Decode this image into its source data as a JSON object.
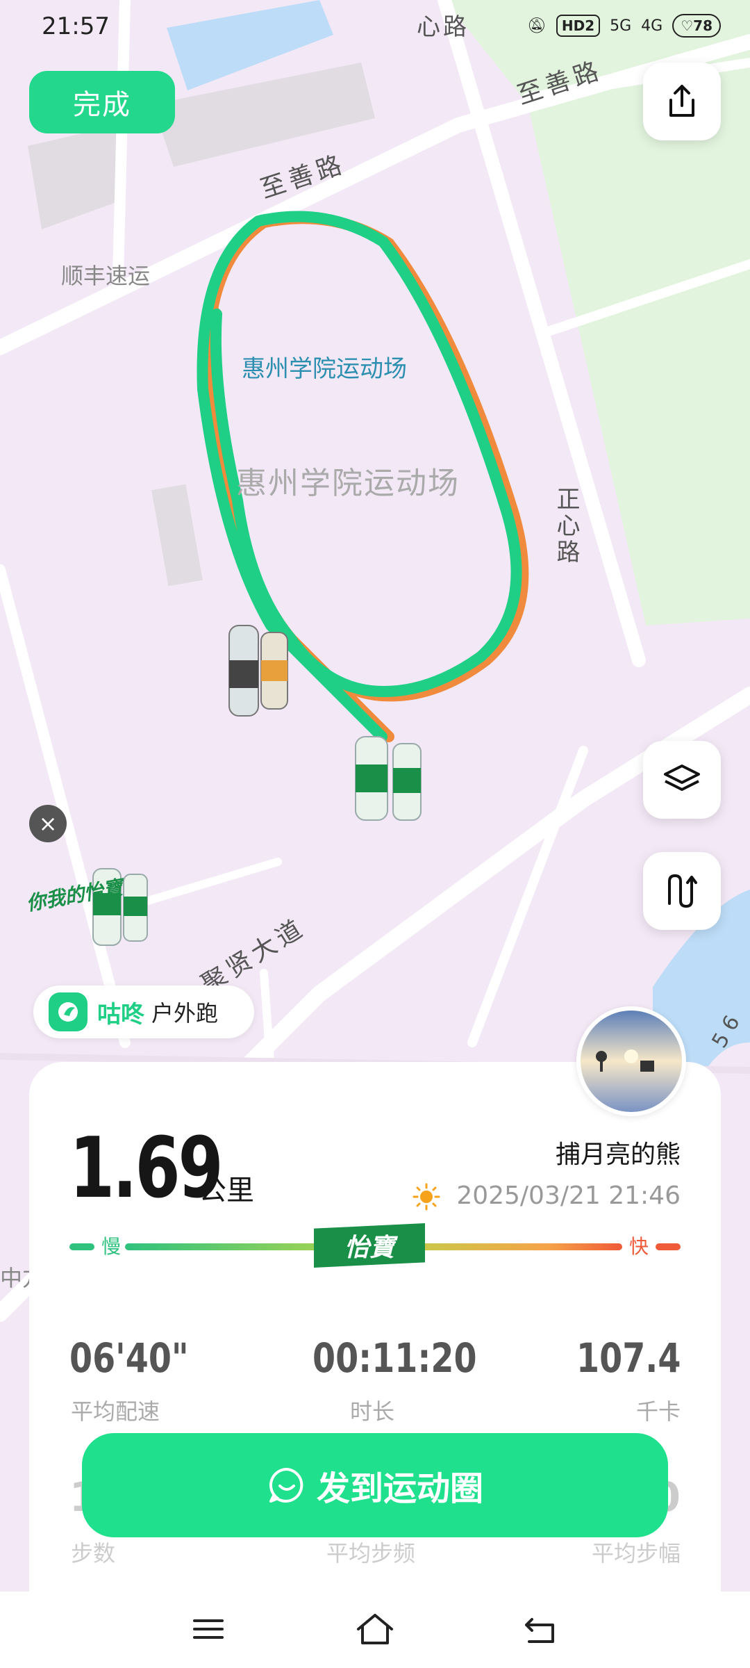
{
  "status": {
    "time": "21:57",
    "network": [
      "HD2",
      "5G",
      "4G"
    ],
    "battery": "78"
  },
  "toolbar": {
    "done_label": "完成"
  },
  "map": {
    "labels": {
      "road_top": "至善路",
      "road_top_right": "至善路",
      "road_vertical_top": "心路",
      "road_right": "正心路",
      "road_bottom": "聚贤大道",
      "poi_left": "顺丰速运",
      "stadium_blue": "惠州学院运动场",
      "stadium_grey": "惠州学院运动场",
      "edge_left": "中方",
      "edge_right": "5 6"
    },
    "ad_brand_text": "你我的怡寶"
  },
  "app_tag": {
    "name": "咕咚",
    "mode": "户外跑"
  },
  "summary": {
    "distance": "1.69",
    "distance_unit": "公里",
    "username": "捕月亮的熊",
    "datetime": "2025/03/21 21:46",
    "weather_icon": "sun-icon"
  },
  "pace_scale": {
    "slow_label": "慢",
    "fast_label": "快",
    "brand_label": "怡寶",
    "colors": {
      "slow": "#2ec27e",
      "mid": "#b9d64a",
      "fast": "#ef5a38"
    }
  },
  "metrics": [
    {
      "value": "06'40\"",
      "label": "平均配速"
    },
    {
      "value": "00:11:20",
      "label": "时长"
    },
    {
      "value": "107.4",
      "label": "千卡"
    }
  ],
  "hidden_metrics": {
    "left_value": "1",
    "right_value": "0",
    "labels": [
      "步数",
      "平均步频",
      "平均步幅"
    ]
  },
  "post_button": {
    "label": "发到运动圈"
  },
  "colors": {
    "accent": "#1ee08d",
    "route_green": "#1fcf86",
    "route_orange": "#f08a3c",
    "map_bg": "#f3e8f6",
    "park": "#e3f5e1"
  }
}
